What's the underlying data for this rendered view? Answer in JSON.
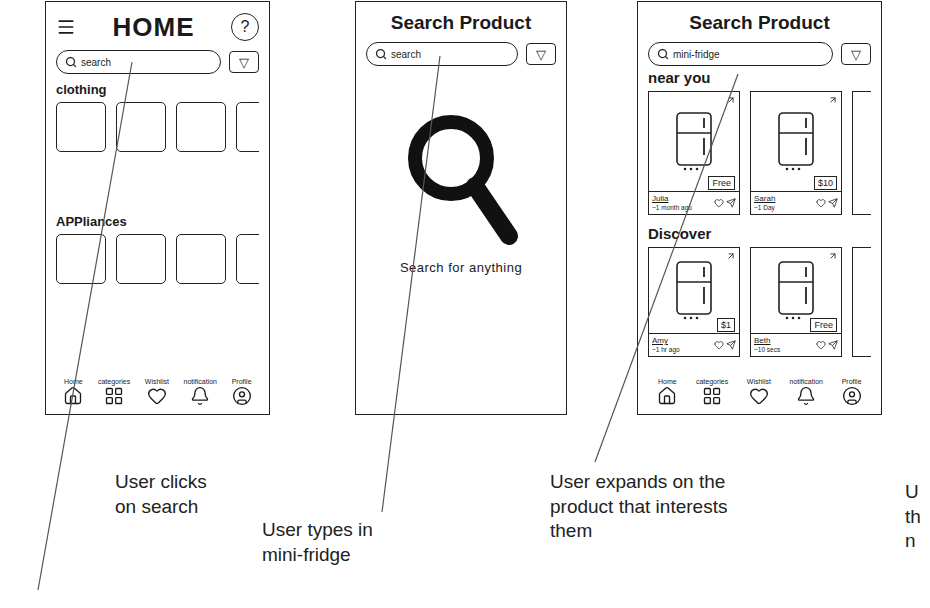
{
  "screens": [
    {
      "kind": "home",
      "title": "HOME",
      "help": "?",
      "search": {
        "placeholder": "search"
      },
      "filter": "▽",
      "sections": [
        {
          "label": "clothing",
          "tiles": 4
        },
        {
          "label": "APPliances",
          "tiles": 4
        }
      ],
      "nav": [
        {
          "label": "Home",
          "selected": false
        },
        {
          "label": "categories",
          "selected": false
        },
        {
          "label": "Wishlist",
          "selected": false
        },
        {
          "label": "notification",
          "selected": false
        },
        {
          "label": "Profile",
          "selected": false
        }
      ]
    },
    {
      "kind": "empty-search",
      "title": "Search Product",
      "search": {
        "placeholder": "search"
      },
      "filter": "▽",
      "message": "Search for anything"
    },
    {
      "kind": "results",
      "title": "Search Product",
      "search": {
        "value": "mini-fridge"
      },
      "filter": "▽",
      "sections": [
        {
          "label": "near you",
          "more": true,
          "products": [
            {
              "seller": "Julia",
              "time": "~1 month ago",
              "price": "Free"
            },
            {
              "seller": "Sarah",
              "time": "~1 Day",
              "price": "$10"
            }
          ]
        },
        {
          "label": "Discover",
          "more": true,
          "products": [
            {
              "seller": "Amy",
              "time": "~1 hr ago",
              "price": "$1"
            },
            {
              "seller": "Beth",
              "time": "~10 secs",
              "price": "Free"
            }
          ]
        }
      ],
      "nav": [
        {
          "label": "Home",
          "selected": false
        },
        {
          "label": "categories",
          "selected": false
        },
        {
          "label": "Wishlist",
          "selected": false
        },
        {
          "label": "notification",
          "selected": false
        },
        {
          "label": "Profile",
          "selected": false
        }
      ]
    }
  ],
  "captions": [
    {
      "lines": [
        "User clicks",
        "on search"
      ],
      "arrow": true
    },
    {
      "lines": [
        "User types in",
        "mini-fridge"
      ],
      "arrow": true
    },
    {
      "lines": [
        "User expands on the",
        "product that interests",
        "them"
      ],
      "arrow": true
    },
    {
      "lines": [
        "U",
        "th",
        "n"
      ],
      "arrow": false
    }
  ]
}
